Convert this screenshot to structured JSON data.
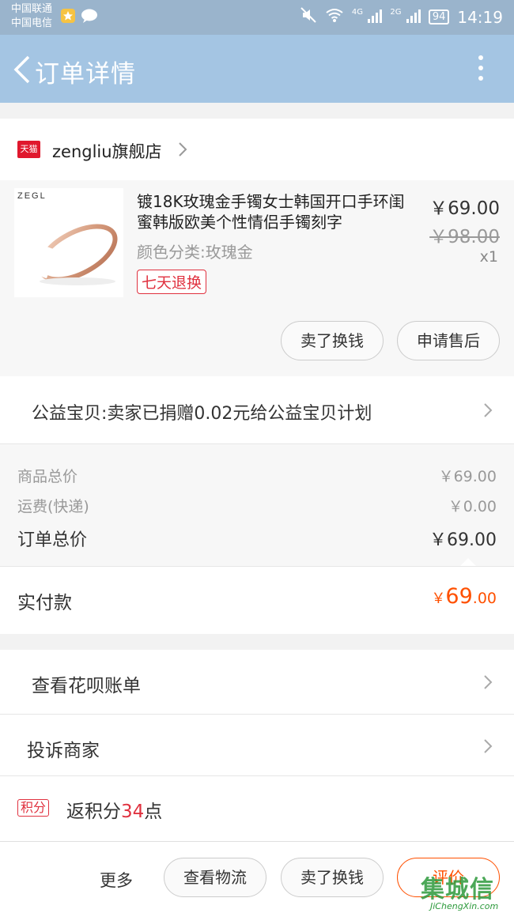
{
  "status_bar": {
    "carrier1": "中国联通",
    "carrier2": "中国电信",
    "net_4g": "4G",
    "net_2g": "2G",
    "battery": "94",
    "time": "14:19"
  },
  "header": {
    "title": "订单详情"
  },
  "shop": {
    "badge": "天猫",
    "name": "zengliu旗舰店"
  },
  "item": {
    "thumb_brand": "ZEGL",
    "title": "镀18K玫瑰金手镯女士韩国开口手环闺蜜韩版欧美个性情侣手镯刻字",
    "spec": "颜色分类:玫瑰金",
    "tag": "七天退换",
    "price": "￥69.00",
    "original_price": "￥98.00",
    "quantity": "x1",
    "buttons": {
      "sell": "卖了换钱",
      "after_sale": "申请售后"
    }
  },
  "charity": {
    "text": "公益宝贝:卖家已捐赠0.02元给公益宝贝计划"
  },
  "summary": {
    "goods_total_label": "商品总价",
    "goods_total_value": "￥69.00",
    "shipping_label": "运费(快递)",
    "shipping_value": "￥0.00",
    "order_total_label": "订单总价",
    "order_total_value": "￥69.00"
  },
  "paid": {
    "label": "实付款",
    "currency": "￥",
    "integer": "69",
    "decimal": ".00"
  },
  "links": {
    "huabei": "查看花呗账单",
    "complain": "投诉商家"
  },
  "points": {
    "badge": "积分",
    "prefix": "返积分",
    "number": "34",
    "suffix": "点"
  },
  "bottom_bar": {
    "more": "更多",
    "logistics": "查看物流",
    "sell": "卖了换钱",
    "review": "评价"
  },
  "watermark": {
    "logo": "集城信",
    "url": "JiChengXin.com"
  },
  "colors": {
    "accent": "#ff5000",
    "tmall_red": "#e0182d",
    "header_bg": "#a4c5e3"
  }
}
